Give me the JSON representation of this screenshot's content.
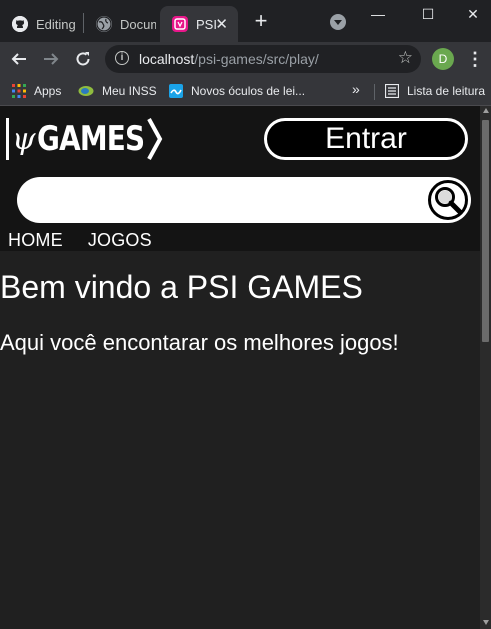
{
  "browser": {
    "tabs": [
      {
        "title": "Editing",
        "icon": "github-icon"
      },
      {
        "title": "Docum",
        "icon": "globe-icon"
      },
      {
        "title": "PSI",
        "icon": "site-favicon-icon",
        "active": true
      }
    ],
    "tab_close": "✕",
    "new_tab": "+",
    "window_controls": {
      "minimize": "—",
      "maximize": "☐",
      "close": "✕"
    },
    "address": {
      "host": "localhost",
      "path": "/psi-games/src/play/",
      "info": "i"
    },
    "profile_initial": "D",
    "bookmarks": [
      {
        "label": "Apps",
        "icon": "apps-grid-icon"
      },
      {
        "label": "Meu INSS",
        "icon": "inss-icon"
      },
      {
        "label": "Novos óculos de lei...",
        "icon": "bookmark-site-icon"
      }
    ],
    "bookmarks_more": "»",
    "reading_list": "Lista de leitura"
  },
  "site": {
    "logo": {
      "psi": "ψ",
      "word": "GAMES"
    },
    "login_button": "Entrar",
    "search": {
      "placeholder": "",
      "value": ""
    },
    "nav": [
      {
        "label": "HOME"
      },
      {
        "label": "JOGOS"
      }
    ],
    "welcome_title": "Bem vindo a PSI GAMES",
    "welcome_subtitle": "Aqui você encontarar os melhores jogos!"
  },
  "colors": {
    "page_bg": "#202020",
    "header_bg": "#141414",
    "accent_favicon": "#e8178a",
    "profile": "#6aa84f"
  }
}
